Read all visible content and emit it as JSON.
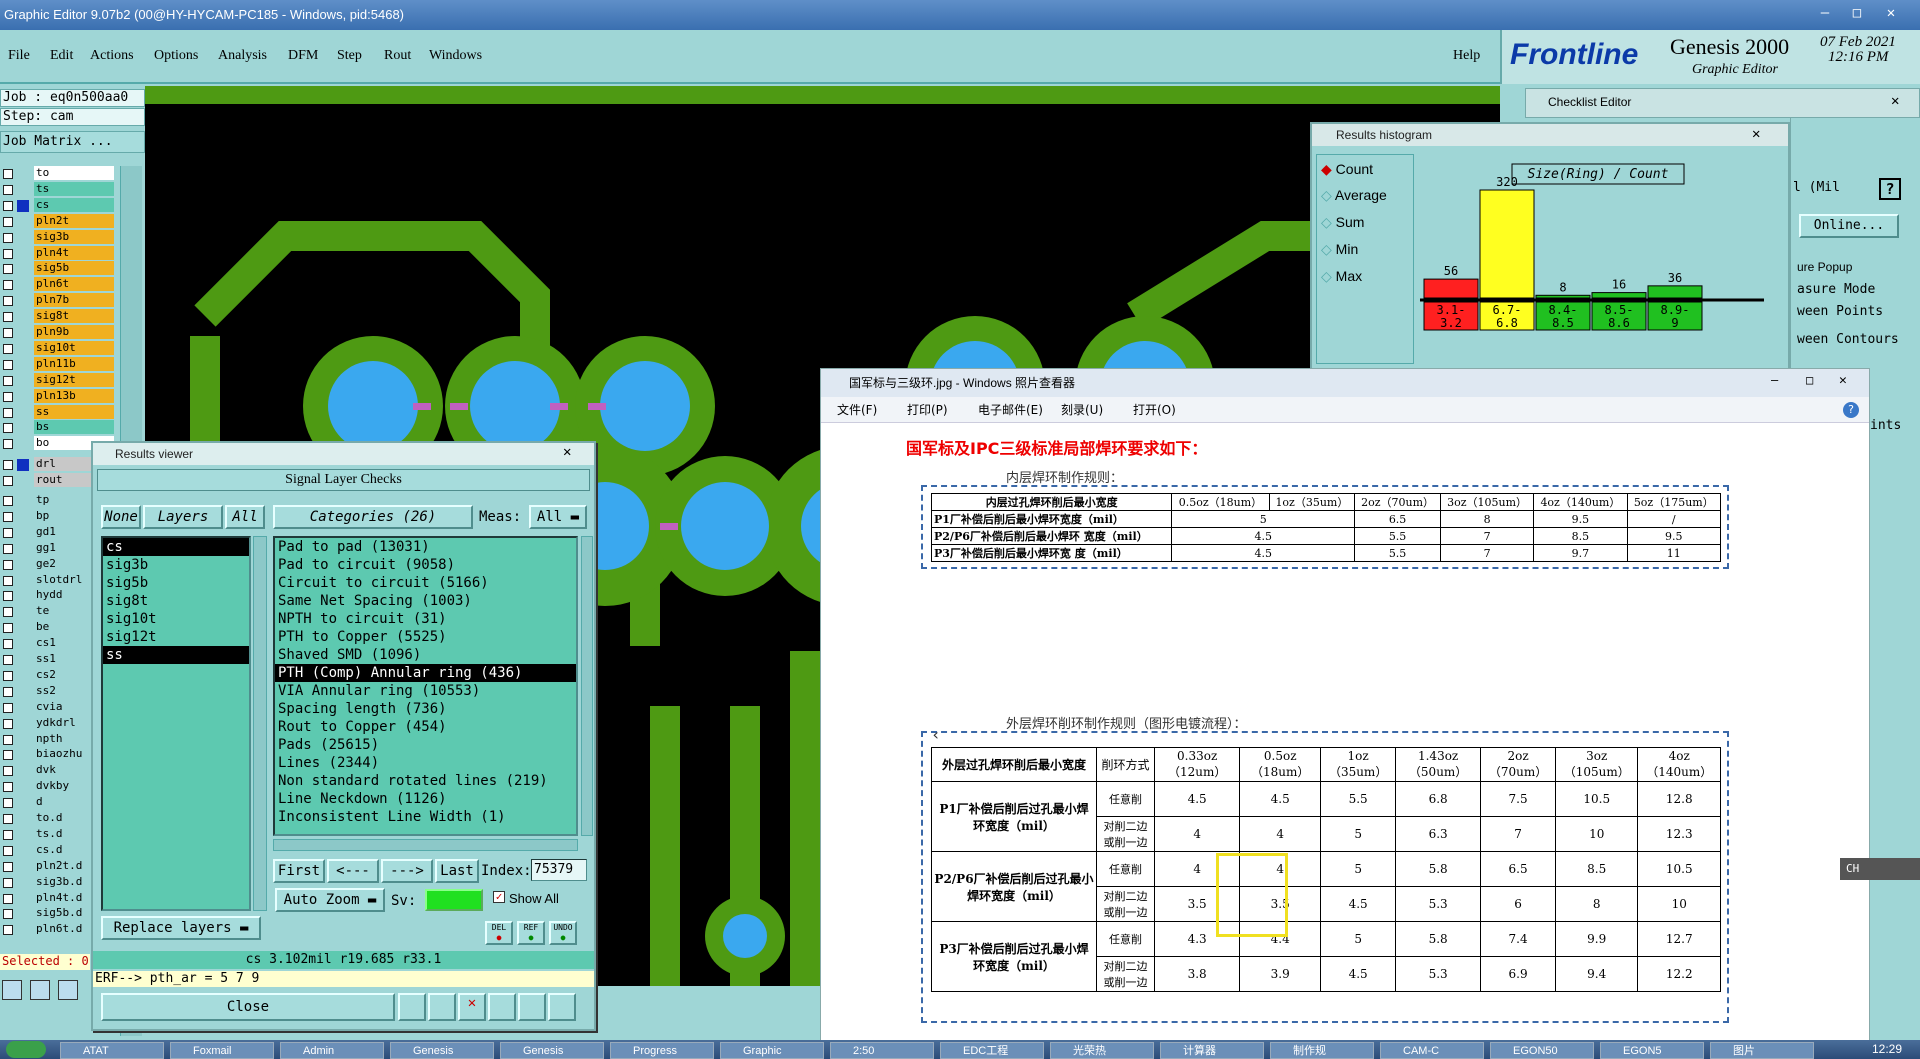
{
  "window": {
    "title": "Graphic Editor 9.07b2 (00@HY-HYCAM-PC185 - Windows, pid:5468)"
  },
  "menu": [
    "File",
    "Edit",
    "Actions",
    "Options",
    "Analysis",
    "DFM",
    "Step",
    "Rout",
    "Windows"
  ],
  "help_label": "Help",
  "brand": {
    "logo": "Frontline",
    "product": "Genesis 2000",
    "subtitle": "Graphic Editor",
    "date": "07 Feb 2021",
    "time": "12:16 PM"
  },
  "job": {
    "job_line": "Job : eq0n500aa0",
    "step_line": "Step: cam",
    "matrix_button": "Job Matrix ...",
    "layers": [
      "to",
      "ts",
      "cs",
      "pln2t",
      "sig3b",
      "pln4t",
      "sig5b",
      "pln6t",
      "pln7b",
      "sig8t",
      "pln9b",
      "sig10t",
      "pln11b",
      "sig12t",
      "pln13b",
      "ss",
      "bs",
      "bo",
      "drl",
      "rout",
      "tp",
      "bp",
      "gd1",
      "gg1",
      "ge2",
      "slotdrl",
      "hydd",
      "te",
      "be",
      "cs1",
      "ss1",
      "cs2",
      "ss2",
      "cvia",
      "ydkdrl",
      "npth",
      "biaozhu",
      "dvk",
      "dvkby",
      "d",
      "to.d",
      "ts.d",
      "cs.d",
      "pln2t.d",
      "sig3b.d",
      "pln4t.d",
      "sig5b.d",
      "pln6t.d"
    ],
    "selected": "Selected : 0"
  },
  "results_viewer": {
    "window_title": "Results viewer",
    "header": "Signal Layer Checks",
    "none_btn": "None",
    "layers_btn": "Layers",
    "all_btn": "All",
    "categories_btn": "Categories (26)",
    "meas_label": "Meas:",
    "meas_value": "All",
    "layers": [
      "cs",
      "sig3b",
      "sig5b",
      "sig8t",
      "sig10t",
      "sig12t",
      "ss"
    ],
    "categories": [
      "Pad to pad (13031)",
      "Pad to circuit (9058)",
      "Circuit to circuit (5166)",
      "Same Net Spacing (1003)",
      "NPTH to circuit (31)",
      "PTH to Copper (5525)",
      "Shaved SMD (1096)",
      "PTH (Comp) Annular ring (436)",
      "VIA Annular ring (10553)",
      "Spacing length (736)",
      "Rout to Copper (454)",
      "Pads (25615)",
      "Lines (2344)",
      "Non standard rotated lines (219)",
      "Line Neckdown (1126)",
      "Inconsistent Line Width (1)"
    ],
    "first_btn": "First",
    "prev_btn": "<---",
    "next_btn": "--->",
    "last_btn": "Last",
    "index_label": "Index:",
    "index_value": "75379",
    "auto_zoom": "Auto Zoom",
    "sv_label": "Sv:",
    "show_all": "Show All",
    "del": "DEL",
    "ref": "REF",
    "undo": "UNDO",
    "replace_layers": "Replace layers",
    "status": "cs 3.102mil  r19.685  r33.1",
    "erf": "ERF--> pth_ar = 5 7 9",
    "close_btn": "Close"
  },
  "histogram": {
    "window_title": "Results histogram",
    "checklist_title": "Checklist Editor",
    "measure_title": "ure Popup",
    "options": [
      "Count",
      "Average",
      "Sum",
      "Min",
      "Max"
    ],
    "selected_option": "Count",
    "chart_title": "Size(Ring) / Count",
    "online": "Online...",
    "mil_text": "l (Mil",
    "measure_items": [
      "asure Mode",
      "ween Points",
      "ween Contours",
      "ints"
    ]
  },
  "chart_data": {
    "type": "bar",
    "title": "Size(Ring) / Count",
    "categories": [
      "3.1-3.2",
      "6.7-6.8",
      "8.4-8.5",
      "8.5-8.6",
      "8.9-9"
    ],
    "values": [
      56,
      320,
      8,
      16,
      36
    ],
    "colors": [
      "#ff2020",
      "#ffff20",
      "#20c020",
      "#20c020",
      "#20c020"
    ]
  },
  "photo_viewer": {
    "title": "国军标与三级环.jpg - Windows 照片查看器",
    "menu": [
      "文件(F)",
      "打印(P)",
      "电子邮件(E)",
      "刻录(U)",
      "打开(O)"
    ],
    "heading": "国军标及IPC三级标准局部焊环要求如下：",
    "inner_caption": "内层焊环制作规则：",
    "inner_header": [
      "内层过孔焊环削后最小宽度",
      "0.5oz（18um）",
      "1oz（35um）",
      "2oz（70um）",
      "3oz（105um）",
      "4oz（140um）",
      "5oz（175um）"
    ],
    "inner_rows": [
      [
        "P1厂补偿后削后最小焊环宽度（mil）",
        "5",
        "6.5",
        "8",
        "9.5",
        "/"
      ],
      [
        "P2/P6厂补偿后削后最小焊环 宽度（mil）",
        "4.5",
        "5.5",
        "7",
        "8.5",
        "9.5"
      ],
      [
        "P3厂补偿后削后最小焊环宽 度（mil）",
        "4.5",
        "5.5",
        "7",
        "9.7",
        "11"
      ]
    ],
    "outer_caption": "外层焊环削环制作规则（图形电镀流程）：",
    "outer_header": [
      "外层过孔焊环削后最小宽度",
      "削环方式",
      "0.33oz（12um）",
      "0.5oz（18um）",
      "1oz（35um）",
      "1.43oz（50um）",
      "2oz（70um）",
      "3oz（105um）",
      "4oz（140um）"
    ],
    "outer_groups": [
      {
        "name": "P1厂补偿后削后过孔最小焊环宽度（mil）",
        "rows": [
          [
            "任意削",
            "4.5",
            "4.5",
            "5.5",
            "6.8",
            "7.5",
            "10.5",
            "12.8"
          ],
          [
            "对削二边或削一边",
            "4",
            "4",
            "5",
            "6.3",
            "7",
            "10",
            "12.3"
          ]
        ]
      },
      {
        "name": "P2/P6厂补偿后削后过孔最小焊环宽度（mil）",
        "rows": [
          [
            "任意削",
            "4",
            "4",
            "5",
            "5.8",
            "6.5",
            "8.5",
            "10.5"
          ],
          [
            "对削二边或削一边",
            "3.5",
            "3.5",
            "4.5",
            "5.3",
            "6",
            "8",
            "10"
          ]
        ]
      },
      {
        "name": "P3厂补偿后削后过孔最小焊环宽度（mil）",
        "rows": [
          [
            "任意削",
            "4.3",
            "4.4",
            "5",
            "5.8",
            "7.4",
            "9.9",
            "12.7"
          ],
          [
            "对削二边或削一边",
            "3.8",
            "3.9",
            "4.5",
            "5.3",
            "6.9",
            "9.4",
            "12.2"
          ]
        ]
      }
    ]
  },
  "taskbar": {
    "items": [
      "ATAT",
      "Foxmail",
      "Admin",
      "Genesis",
      "Genesis",
      "Progress",
      "Graphic",
      "2:50",
      "EDC工程",
      "光荣热",
      "计算器",
      "制作规",
      "CAM-C",
      "EGON50",
      "EGON5",
      "图片"
    ],
    "clock": "12:29",
    "ime": "CH"
  }
}
